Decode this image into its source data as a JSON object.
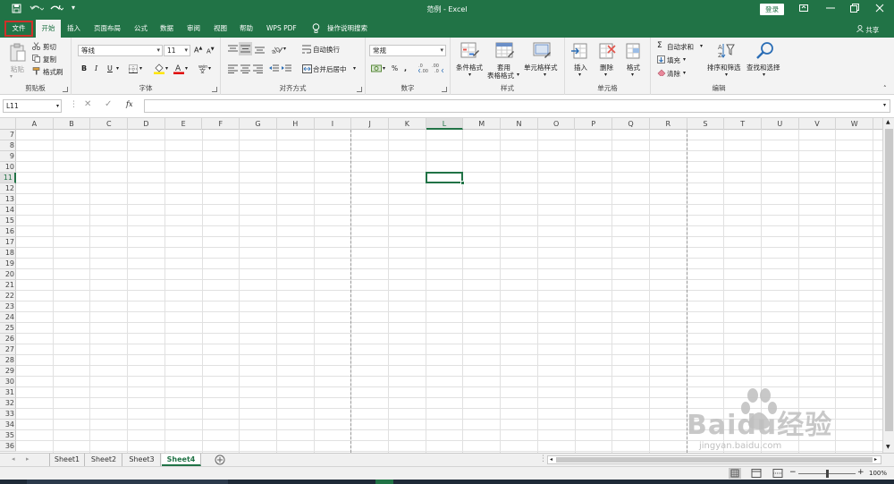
{
  "window": {
    "title": "范例 - Excel",
    "login_label": "登录",
    "share_label": "共享"
  },
  "menu": {
    "tabs": [
      "文件",
      "开始",
      "插入",
      "页面布局",
      "公式",
      "数据",
      "审阅",
      "视图",
      "帮助",
      "WPS PDF"
    ],
    "active_tab": "开始",
    "highlighted_tab": "文件",
    "tell_me": "操作说明搜索"
  },
  "ribbon": {
    "clipboard": {
      "label": "剪贴板",
      "paste": "粘贴",
      "cut": "剪切",
      "copy": "复制",
      "format_painter": "格式刷"
    },
    "font": {
      "label": "字体",
      "font_name": "等线",
      "font_size": "11",
      "bold": "B",
      "italic": "I",
      "underline": "U"
    },
    "alignment": {
      "label": "对齐方式",
      "wrap": "自动换行",
      "merge": "合并后居中"
    },
    "number": {
      "label": "数字",
      "format": "常规",
      "percent": "%"
    },
    "styles": {
      "label": "样式",
      "conditional": "条件格式",
      "table_line1": "套用",
      "table_line2": "表格格式",
      "cell_styles": "单元格样式"
    },
    "cells": {
      "label": "单元格",
      "insert": "插入",
      "delete": "删除",
      "format": "格式"
    },
    "editing": {
      "label": "编辑",
      "autosum": "自动求和",
      "fill": "填充",
      "clear": "清除",
      "sort": "排序和筛选",
      "find": "查找和选择"
    }
  },
  "formula_bar": {
    "name_box": "L11",
    "fx": "fx",
    "content": ""
  },
  "grid": {
    "columns": [
      "A",
      "B",
      "C",
      "D",
      "E",
      "F",
      "G",
      "H",
      "I",
      "J",
      "K",
      "L",
      "M",
      "N",
      "O",
      "P",
      "Q",
      "R",
      "S",
      "T",
      "U",
      "V",
      "W"
    ],
    "rows": [
      "7",
      "8",
      "9",
      "10",
      "11",
      "12",
      "13",
      "14",
      "15",
      "16",
      "17",
      "18",
      "19",
      "20",
      "21",
      "22",
      "23",
      "24",
      "25",
      "26",
      "27",
      "28",
      "29",
      "30",
      "31",
      "32",
      "33",
      "34",
      "35",
      "36"
    ],
    "active_cell": "L11",
    "active_column": "L",
    "active_row": "11"
  },
  "sheets": {
    "tabs": [
      "Sheet1",
      "Sheet2",
      "Sheet3",
      "Sheet4"
    ],
    "active": "Sheet4"
  },
  "status": {
    "zoom": "100%"
  },
  "watermark": {
    "text": "Baidu经验",
    "url": "jingyan.baidu.com"
  },
  "colors": {
    "excel_green": "#217346",
    "file_highlight": "#d0302a"
  }
}
